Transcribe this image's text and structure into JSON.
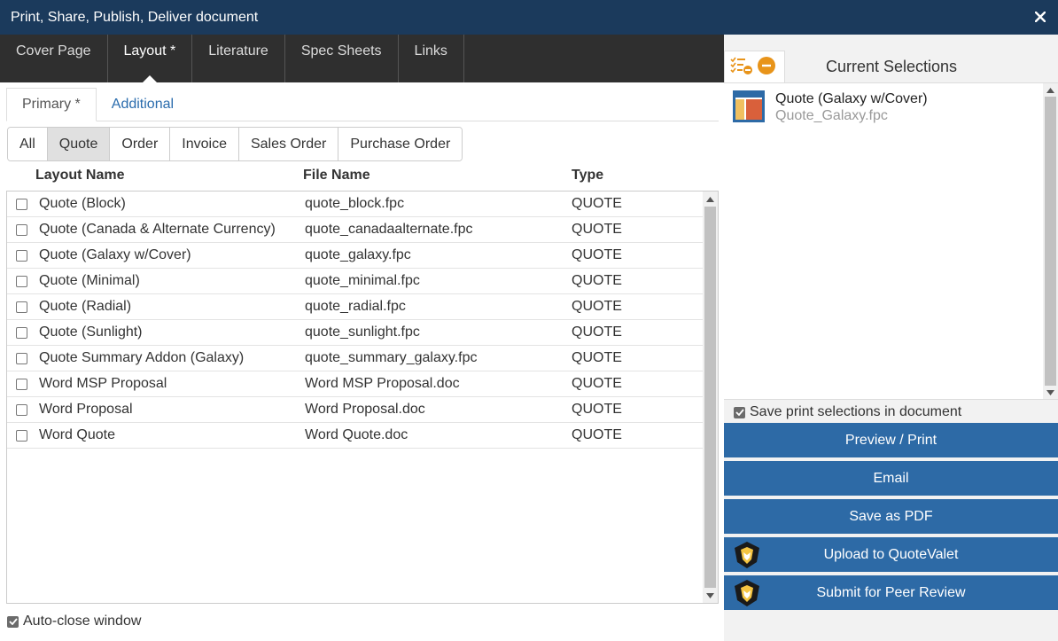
{
  "window": {
    "title": "Print, Share, Publish, Deliver document"
  },
  "main_tabs": [
    {
      "label": "Cover Page"
    },
    {
      "label": "Layout *"
    },
    {
      "label": "Literature"
    },
    {
      "label": "Spec Sheets"
    },
    {
      "label": "Links"
    }
  ],
  "sub_tabs": [
    {
      "label": "Primary *"
    },
    {
      "label": "Additional"
    }
  ],
  "filters": [
    {
      "label": "All"
    },
    {
      "label": "Quote"
    },
    {
      "label": "Order"
    },
    {
      "label": "Invoice"
    },
    {
      "label": "Sales Order"
    },
    {
      "label": "Purchase Order"
    }
  ],
  "table": {
    "headers": {
      "name": "Layout Name",
      "file": "File Name",
      "type": "Type"
    },
    "rows": [
      {
        "name": "Quote (Block)",
        "file": "quote_block.fpc",
        "type": "QUOTE"
      },
      {
        "name": "Quote (Canada & Alternate Currency)",
        "file": "quote_canadaalternate.fpc",
        "type": "QUOTE"
      },
      {
        "name": "Quote (Galaxy w/Cover)",
        "file": "quote_galaxy.fpc",
        "type": "QUOTE"
      },
      {
        "name": "Quote (Minimal)",
        "file": "quote_minimal.fpc",
        "type": "QUOTE"
      },
      {
        "name": "Quote (Radial)",
        "file": "quote_radial.fpc",
        "type": "QUOTE"
      },
      {
        "name": "Quote (Sunlight)",
        "file": "quote_sunlight.fpc",
        "type": "QUOTE"
      },
      {
        "name": "Quote Summary Addon (Galaxy)",
        "file": "quote_summary_galaxy.fpc",
        "type": "QUOTE"
      },
      {
        "name": "Word MSP Proposal",
        "file": "Word MSP Proposal.doc",
        "type": "QUOTE"
      },
      {
        "name": "Word Proposal",
        "file": "Word Proposal.doc",
        "type": "QUOTE"
      },
      {
        "name": "Word Quote",
        "file": "Word Quote.doc",
        "type": "QUOTE"
      }
    ]
  },
  "auto_close": {
    "label": "Auto-close window"
  },
  "right_panel": {
    "title": "Current Selections",
    "selection": {
      "name": "Quote (Galaxy w/Cover)",
      "file": "Quote_Galaxy.fpc"
    },
    "save_selections_label": "Save print selections in document",
    "buttons": [
      {
        "label": "Preview / Print"
      },
      {
        "label": "Email"
      },
      {
        "label": "Save as PDF"
      },
      {
        "label": "Upload to QuoteValet"
      },
      {
        "label": "Submit for Peer Review"
      }
    ]
  },
  "colors": {
    "titlebar": "#1b3a5c",
    "tabbar": "#2f2f2f",
    "action_button": "#2d6aa6",
    "link": "#2a6cad",
    "icon_orange": "#e8941a"
  }
}
